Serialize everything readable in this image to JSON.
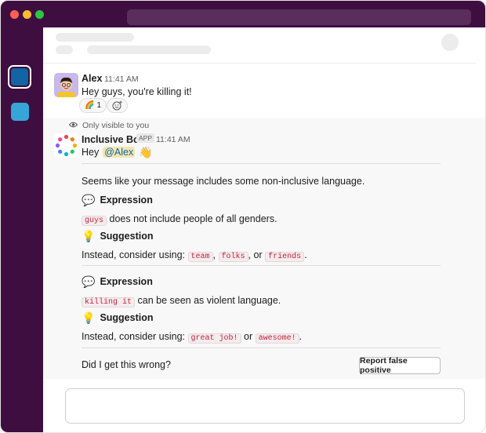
{
  "messages": {
    "alex": {
      "author": "Alex",
      "time": "11:41 AM",
      "text": "Hey guys, you're killing it!",
      "reaction": {
        "emoji": "🌈",
        "count": "1"
      }
    },
    "bot": {
      "visibility": "Only visible to you",
      "author": "Inclusive Bot",
      "badge": "APP",
      "time": "11:41 AM",
      "greeting": "Hey",
      "mention": "@Alex",
      "wave": "👋",
      "intro": "Seems like your message includes some non-inclusive language.",
      "findings": [
        {
          "expression_label": "Expression",
          "term": "guys",
          "explanation": "does not include people of all genders.",
          "suggestion_label": "Suggestion",
          "suggestion_prefix": "Instead, consider using:",
          "alternatives": [
            "team",
            "folks",
            "friends"
          ],
          "separators": [
            ",",
            ", or",
            "."
          ]
        },
        {
          "expression_label": "Expression",
          "term": "killing it",
          "explanation": "can be seen as violent language.",
          "suggestion_label": "Suggestion",
          "suggestion_prefix": "Instead, consider using:",
          "alternatives": [
            "great job!",
            "awesome!"
          ],
          "separators": [
            "or",
            "."
          ]
        }
      ],
      "feedback_question": "Did I get this wrong?",
      "report_button": "Report false positive"
    }
  },
  "icons": {
    "expression": "💬",
    "suggestion": "💡",
    "visibility": "eye-icon",
    "add_reaction": "add-reaction-icon"
  },
  "colors": {
    "sidebar": "#3f0e40",
    "code_text": "#c0243b",
    "mention_bg": "#f2e6b3"
  }
}
